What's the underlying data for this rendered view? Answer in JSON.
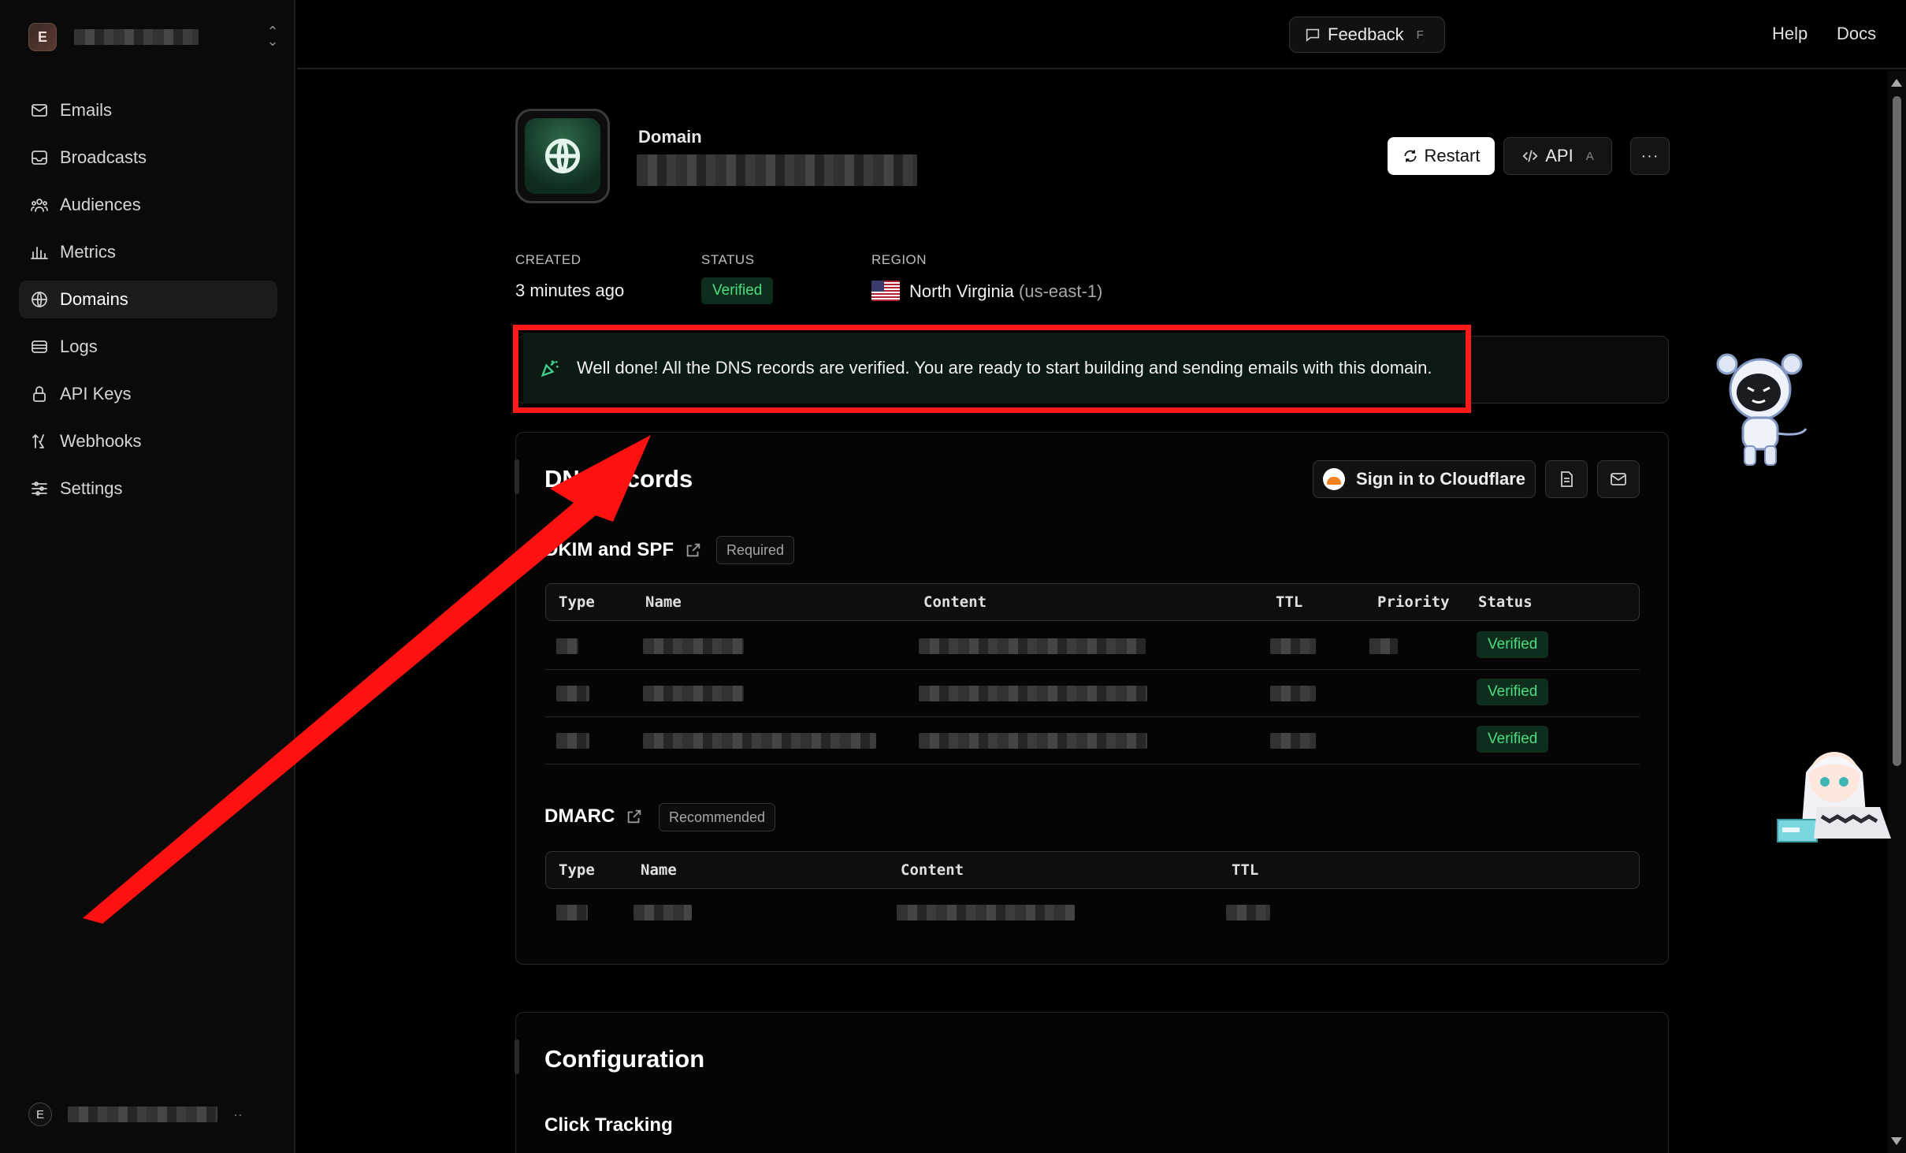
{
  "team": {
    "initial": "E"
  },
  "sidebar": {
    "items": [
      {
        "label": "Emails",
        "icon": "mail-icon"
      },
      {
        "label": "Broadcasts",
        "icon": "inbox-icon"
      },
      {
        "label": "Audiences",
        "icon": "users-icon"
      },
      {
        "label": "Metrics",
        "icon": "bar-chart-icon"
      },
      {
        "label": "Domains",
        "icon": "globe-icon",
        "active": true
      },
      {
        "label": "Logs",
        "icon": "list-icon"
      },
      {
        "label": "API Keys",
        "icon": "lock-icon"
      },
      {
        "label": "Webhooks",
        "icon": "webhook-icon"
      },
      {
        "label": "Settings",
        "icon": "sliders-icon"
      }
    ]
  },
  "user": {
    "initial": "E",
    "more": "··"
  },
  "topbar": {
    "feedback": "Feedback",
    "feedback_key": "F",
    "help": "Help",
    "docs": "Docs"
  },
  "header": {
    "label": "Domain",
    "restart": "Restart",
    "api": "API",
    "api_key": "A",
    "more": "···"
  },
  "meta": {
    "created_label": "CREATED",
    "created_value": "3 minutes ago",
    "status_label": "STATUS",
    "status_value": "Verified",
    "region_label": "REGION",
    "region_name": "North Virginia",
    "region_code": "(us-east-1)"
  },
  "banner": {
    "text": "Well done! All the DNS records are verified. You are ready to start building and sending emails with this domain."
  },
  "dns": {
    "title_left": "DN",
    "title_right": "cords",
    "cloudflare": "Sign in to Cloudflare",
    "dkim": {
      "title": "DKIM and SPF",
      "pill": "Required",
      "columns": [
        "Type",
        "Name",
        "Content",
        "TTL",
        "Priority",
        "Status"
      ],
      "rows": [
        {
          "status": "Verified"
        },
        {
          "status": "Verified"
        },
        {
          "status": "Verified"
        }
      ]
    },
    "dmarc": {
      "title": "DMARC",
      "pill": "Recommended",
      "columns": [
        "Type",
        "Name",
        "Content",
        "TTL"
      ]
    }
  },
  "config": {
    "title": "Configuration",
    "click_tracking": "Click Tracking"
  },
  "colors": {
    "accent_green": "#4ade80",
    "annotation_red": "#ff1a1a",
    "banner_bg": "#0b1a12"
  }
}
